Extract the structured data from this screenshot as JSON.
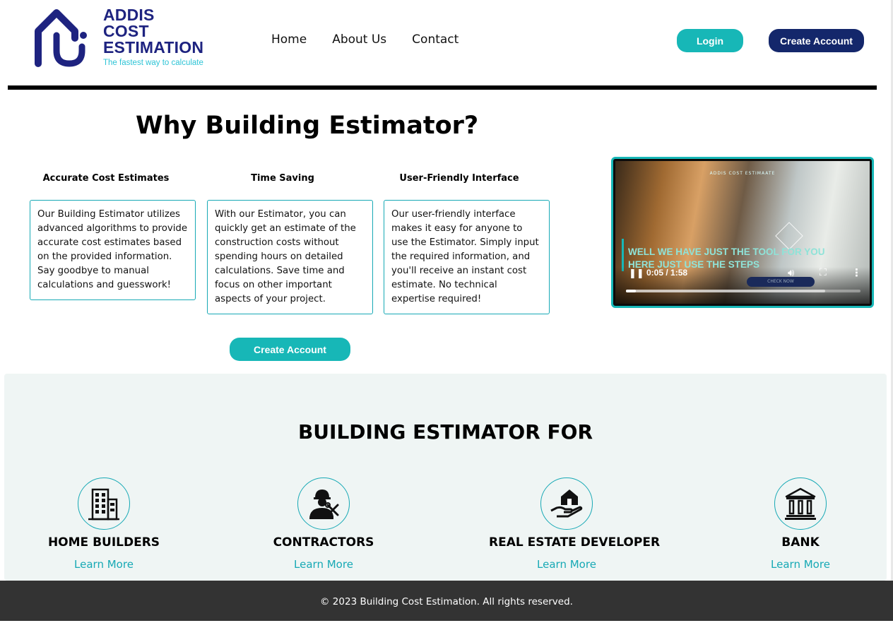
{
  "brand": {
    "line1": "ADDIS",
    "line2": "COST",
    "line3": "ESTIMATION",
    "tagline": "The fastest way to calculate",
    "color_primary": "#1e2380",
    "color_accent": "#2ec4d6"
  },
  "nav": {
    "items": [
      {
        "label": "Home"
      },
      {
        "label": "About Us"
      },
      {
        "label": "Contact"
      }
    ]
  },
  "header": {
    "login_label": "Login",
    "create_account_label": "Create Account"
  },
  "why": {
    "title": "Why Building Estimator?",
    "features": [
      {
        "heading": "Accurate Cost Estimates",
        "body": "Our Building Estimator utilizes advanced algorithms to provide accurate cost estimates based on the provided information. Say goodbye to manual calculations and guesswork!"
      },
      {
        "heading": "Time Saving",
        "body": "With our Estimator, you can quickly get an estimate of the construction costs without spending hours on detailed calculations. Save time and focus on other important aspects of your project."
      },
      {
        "heading": "User-Friendly Interface",
        "body": "Our user-friendly interface makes it easy for anyone to use the Estimator. Simply input the required information, and you'll receive an instant cost estimate. No technical expertise required!"
      }
    ],
    "create_account_label": "Create Account"
  },
  "video": {
    "brand_overlay": "ADDIS COST ESTIMAATE",
    "caption": "WELL WE HAVE JUST THE TOOL FOR YOU HERE JUST USE THE STEPS",
    "pill_text": "CHECK NOW",
    "time": "0:05 / 1:58",
    "progress": 0.042,
    "buffered": 0.85
  },
  "estimator_for": {
    "title": "BUILDING ESTIMATOR FOR",
    "items": [
      {
        "label": "HOME BUILDERS",
        "link": "Learn More",
        "icon": "building-icon"
      },
      {
        "label": "CONTRACTORS",
        "link": "Learn More",
        "icon": "contractor-icon"
      },
      {
        "label": "REAL ESTATE DEVELOPER",
        "link": "Learn More",
        "icon": "house-hand-icon"
      },
      {
        "label": "BANK",
        "link": "Learn More",
        "icon": "bank-icon"
      }
    ]
  },
  "footer": {
    "text": "© 2023 Building Cost Estimation. All rights reserved."
  },
  "colors": {
    "teal": "#17b7b7",
    "navy": "#14276b",
    "section_bg": "#eff5f4",
    "footer_bg": "#333333"
  }
}
